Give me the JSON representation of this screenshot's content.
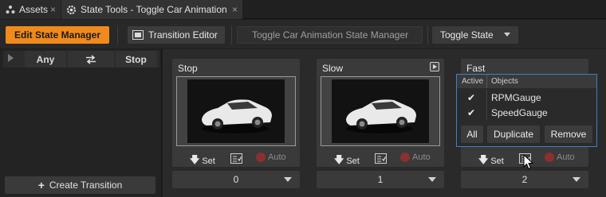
{
  "tabs": [
    {
      "label": "Assets",
      "close": "×",
      "icon": "assets-icon"
    },
    {
      "label": "State Tools - Toggle Car Animation",
      "close": "×",
      "icon": "state-tools-icon"
    }
  ],
  "toolbar": {
    "edit_state_manager": "Edit State Manager",
    "transition_editor": "Transition Editor",
    "state_manager_name": "Toggle Car Animation State Manager",
    "toggle_state": "Toggle State",
    "accent": "#f08a1c"
  },
  "left_panel": {
    "any": "Any",
    "stop": "Stop",
    "create_transition": "Create Transition"
  },
  "states": [
    {
      "title": "Stop",
      "set": "Set",
      "auto": "Auto",
      "value": "0"
    },
    {
      "title": "Slow",
      "set": "Set",
      "auto": "Auto",
      "value": "1"
    },
    {
      "title": "Fast",
      "set": "Set",
      "auto": "Auto",
      "value": "2"
    }
  ],
  "popup": {
    "col_active": "Active",
    "col_objects": "Objects",
    "rows": [
      {
        "check": "✔",
        "name": "RPMGauge"
      },
      {
        "check": "✔",
        "name": "SpeedGauge"
      }
    ],
    "btn_all": "All",
    "btn_duplicate": "Duplicate",
    "btn_remove": "Remove",
    "border_color": "#3f80c8"
  }
}
